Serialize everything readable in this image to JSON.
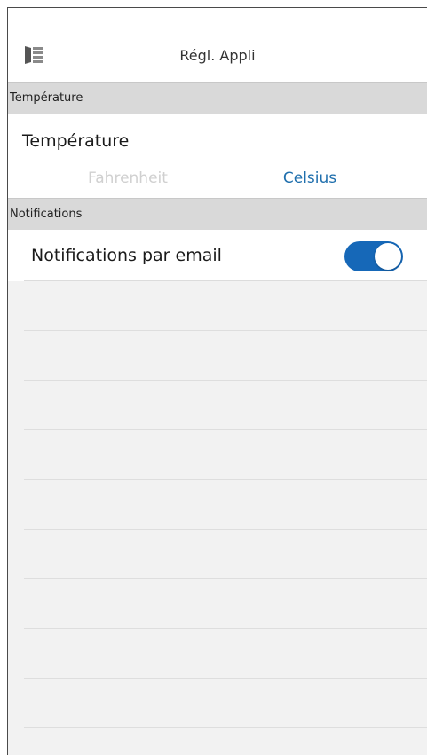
{
  "header": {
    "title": "Régl. Appli",
    "menu_icon": "sidebar-menu-icon"
  },
  "sections": {
    "temperature": {
      "header": "Température",
      "row_label": "Température",
      "options": [
        "Fahrenheit",
        "Celsius"
      ],
      "selected": "Celsius"
    },
    "notifications": {
      "header": "Notifications",
      "row_label": "Notifications par email",
      "toggle_on": true
    }
  },
  "colors": {
    "accent": "#1f6fad",
    "toggle_on": "#1668b8",
    "section_bg": "#d9d9d9",
    "empty_bg": "#f2f2f2"
  }
}
